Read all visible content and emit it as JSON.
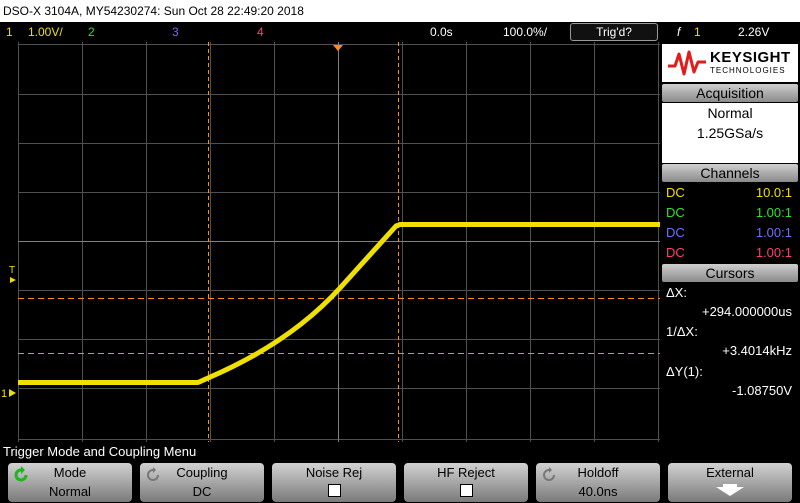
{
  "title_bar": {
    "text": "DSO-X 3104A, MY54230274: Sun Oct 28 22:49:20 2018"
  },
  "status_bar": {
    "ch1_num": "1",
    "ch1_scale": "1.00V/",
    "ch2_num": "2",
    "ch3_num": "3",
    "ch4_num": "4",
    "time_delay": "0.0s",
    "time_scale": "100.0%/",
    "trigger_status": "Trig'd?",
    "trigger_slope": "f",
    "trigger_source": "1",
    "trigger_level": "2.26V"
  },
  "brand": {
    "name": "KEYSIGHT",
    "sub": "TECHNOLOGIES"
  },
  "acquisition": {
    "header": "Acquisition",
    "mode": "Normal",
    "rate": "1.25GSa/s"
  },
  "channels": {
    "header": "Channels",
    "rows": [
      {
        "coupling": "DC",
        "probe": "10.0:1",
        "color": "#f0e000"
      },
      {
        "coupling": "DC",
        "probe": "1.00:1",
        "color": "#30e030"
      },
      {
        "coupling": "DC",
        "probe": "1.00:1",
        "color": "#6f6fff"
      },
      {
        "coupling": "DC",
        "probe": "1.00:1",
        "color": "#ff3f6f"
      }
    ]
  },
  "cursors": {
    "header": "Cursors",
    "dx_label": "ΔX:",
    "dx_value": "+294.000000us",
    "inv_dx_label": "1/ΔX:",
    "inv_dx_value": "+3.4014kHz",
    "dy_label": "ΔY(1):",
    "dy_value": "-1.08750V"
  },
  "markers": {
    "ch1": "1",
    "trigger": "T"
  },
  "menu_title": "Trigger Mode and Coupling Menu",
  "softkeys": [
    {
      "top": "Mode",
      "bottom": "Normal",
      "icon": "rotate-icon"
    },
    {
      "top": "Coupling",
      "bottom": "DC",
      "icon": "rotate-icon"
    },
    {
      "top": "Noise Rej",
      "bottom": "",
      "icon": "checkbox-icon"
    },
    {
      "top": "HF Reject",
      "bottom": "",
      "icon": "checkbox-icon"
    },
    {
      "top": "Holdoff",
      "bottom": "40.0ns",
      "icon": "rotate-icon"
    },
    {
      "top": "External",
      "bottom": "",
      "icon": "down-arrow-icon"
    }
  ],
  "colors": {
    "ch1": "#f0e000",
    "ch2": "#30e030",
    "ch3": "#6f6fff",
    "ch4": "#ff3f6f",
    "cursor": "#ff8c1a",
    "grid": "#505050",
    "brand_red": "#e41b1b"
  }
}
